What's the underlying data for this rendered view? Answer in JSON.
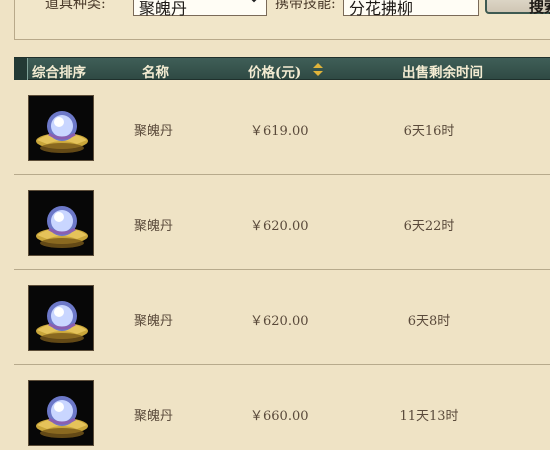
{
  "filters": {
    "type_label": "道具种类:",
    "type_value": "聚魄丹",
    "skill_label": "携带技能:",
    "skill_value": "分花拂柳",
    "search_label": "搜索"
  },
  "table": {
    "headers": {
      "rank": "综合排序",
      "name": "名称",
      "price": "价格(元)",
      "time": "出售剩余时间"
    },
    "rows": [
      {
        "name": "聚魄丹",
        "price": "￥619.00",
        "time": "6天16时"
      },
      {
        "name": "聚魄丹",
        "price": "￥620.00",
        "time": "6天22时"
      },
      {
        "name": "聚魄丹",
        "price": "￥620.00",
        "time": "6天8时"
      },
      {
        "name": "聚魄丹",
        "price": "￥660.00",
        "time": "11天13时"
      }
    ]
  },
  "colors": {
    "header_bg": "#2f4a44",
    "page_bg": "#efe3c5",
    "sort_icon": "#e0b43a"
  },
  "icons": {
    "item": "soul-pill-orb-icon",
    "sort": "sort-arrows-icon",
    "dropdown": "chevron-down-icon"
  }
}
